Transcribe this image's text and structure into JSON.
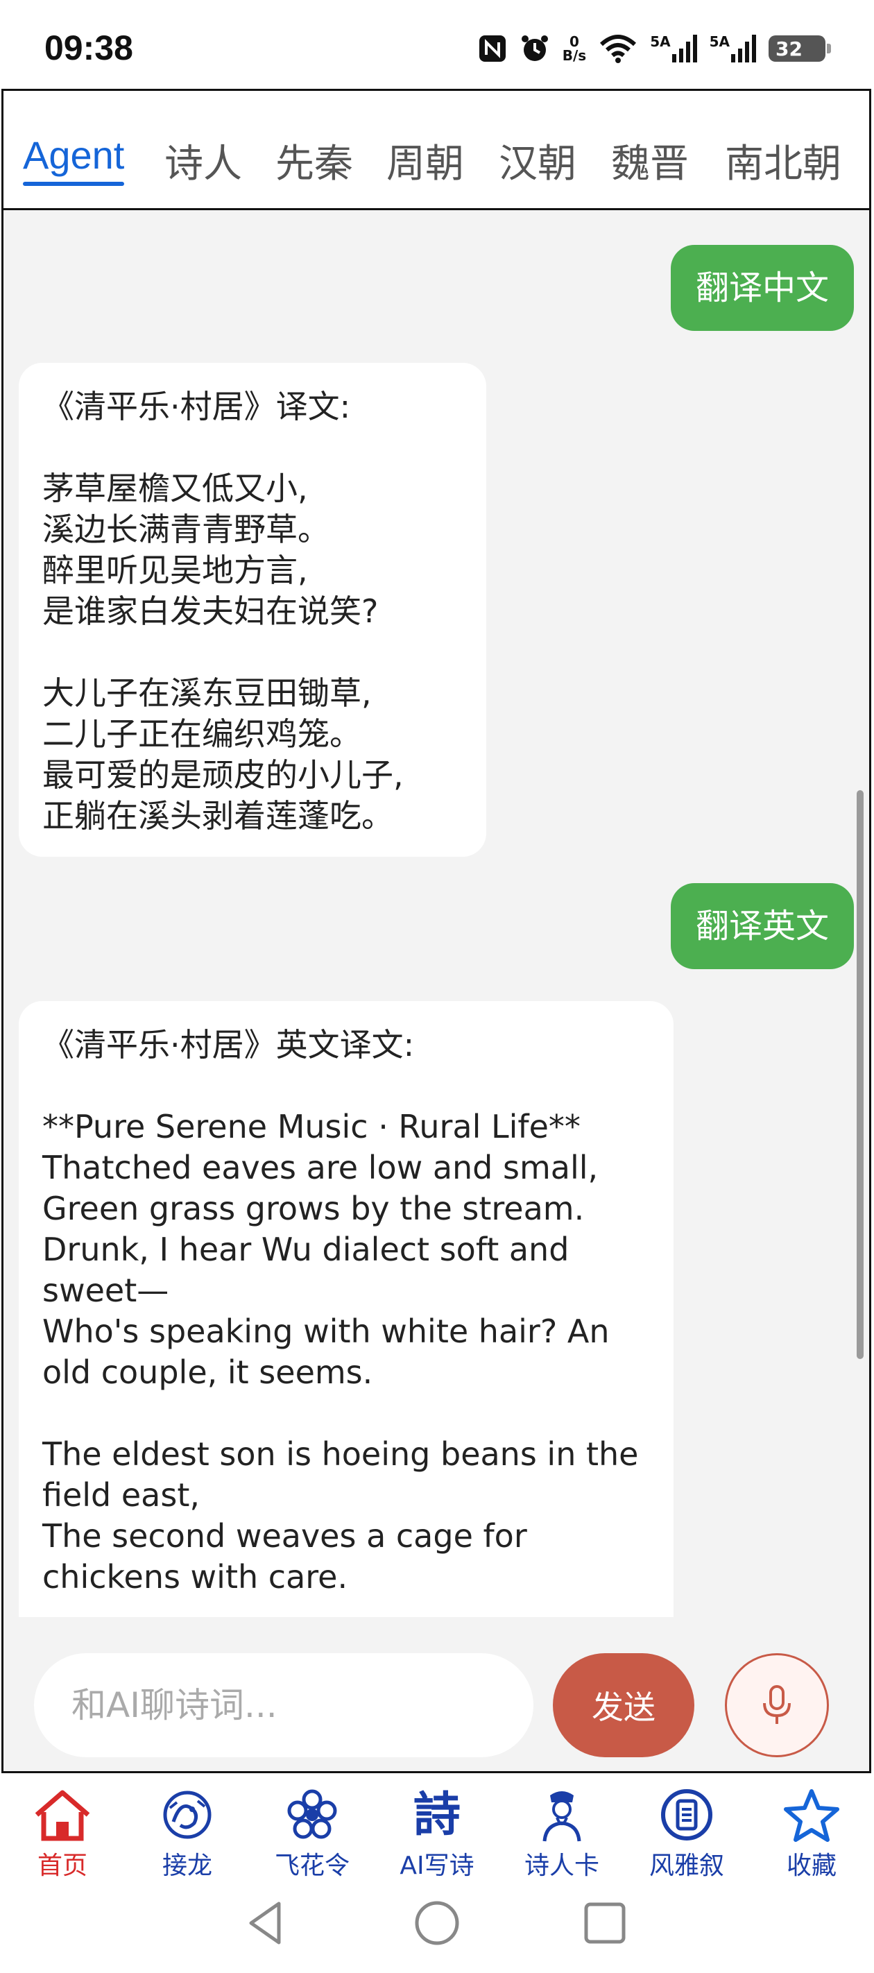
{
  "status_bar": {
    "time": "09:38",
    "net_speed_value": "0",
    "net_speed_unit": "B/s",
    "sim1_label": "5A",
    "sim2_label": "5A",
    "battery": "32"
  },
  "tabs": [
    "Agent",
    "诗人",
    "先秦",
    "周朝",
    "汉朝",
    "魏晋",
    "南北朝"
  ],
  "active_tab": "Agent",
  "messages": [
    {
      "role": "user",
      "text": "翻译中文"
    },
    {
      "role": "assistant",
      "text": "《清平乐·村居》译文:\n\n茅草屋檐又低又小,\n溪边长满青青野草。\n醉里听见吴地方言,\n是谁家白发夫妇在说笑?\n\n大儿子在溪东豆田锄草,\n二儿子正在编织鸡笼。\n最可爱的是顽皮的小儿子,\n正躺在溪头剥着莲蓬吃。"
    },
    {
      "role": "user",
      "text": "翻译英文"
    },
    {
      "role": "assistant",
      "text": "《清平乐·村居》英文译文:\n\n**Pure Serene Music · Rural Life**\nThatched eaves are low and small,\nGreen grass grows by the stream.\nDrunk, I hear Wu dialect soft and sweet—\nWho's speaking with white hair? An old couple, it seems.\n\nThe eldest son is hoeing beans in the field east,\nThe second weaves a cage for chickens with care."
    }
  ],
  "input": {
    "placeholder": "和AI聊诗词...",
    "value": ""
  },
  "send_label": "发送",
  "bottom_nav": [
    {
      "label": "首页",
      "icon": "home-icon",
      "active": true
    },
    {
      "label": "接龙",
      "icon": "dragon-icon",
      "active": false
    },
    {
      "label": "飞花令",
      "icon": "flower-icon",
      "active": false
    },
    {
      "label": "AI写诗",
      "icon": "poem-glyph-icon",
      "glyph": "詩",
      "active": false
    },
    {
      "label": "诗人卡",
      "icon": "poet-portrait-icon",
      "active": false
    },
    {
      "label": "风雅叙",
      "icon": "scroll-circle-icon",
      "active": false
    },
    {
      "label": "收藏",
      "icon": "star-icon",
      "active": false
    }
  ],
  "colors": {
    "accent_blue": "#1565d8",
    "user_bubble": "#4caf50",
    "send_button": "#c85a47",
    "nav_active": "#d82a2a",
    "nav_icon": "#1a3ea8"
  }
}
